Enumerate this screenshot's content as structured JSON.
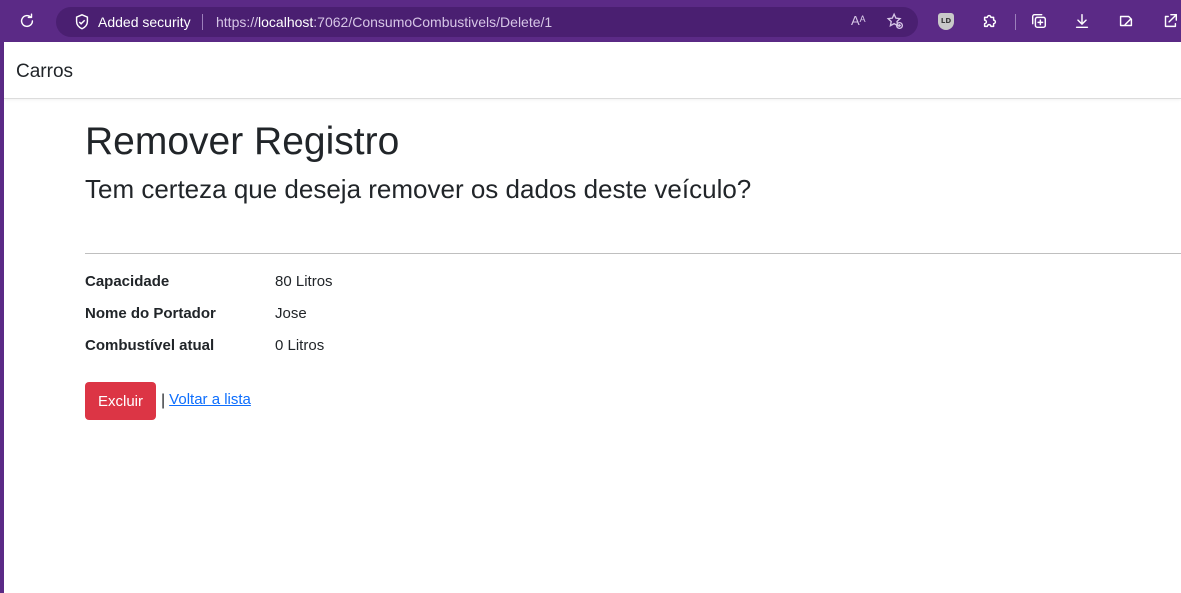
{
  "browser": {
    "security_label": "Added security",
    "url_scheme": "https://",
    "url_host": "localhost",
    "url_rest": ":7062/ConsumoCombustivels/Delete/1",
    "read_aloud_glyph": "Aᴬ",
    "extension_badge": "LD",
    "icons": [
      "refresh-icon",
      "shield-icon",
      "read-aloud-icon",
      "add-favorite-icon",
      "extension-ld-icon",
      "puzzle-icon",
      "collections-icon",
      "download-icon",
      "copilot-icon",
      "share-icon"
    ],
    "accent_color": "#5b2a86"
  },
  "navbar": {
    "brand": "Carros"
  },
  "main": {
    "title": "Remover Registro",
    "subtitle": "Tem certeza que deseja remover os dados deste veículo?",
    "details": [
      {
        "label": "Capacidade",
        "value": "80 Litros"
      },
      {
        "label": "Nome do Portador",
        "value": "Jose"
      },
      {
        "label": "Combustível atual",
        "value": "0 Litros"
      }
    ],
    "delete_button": "Excluir",
    "separator": "|",
    "back_link": "Voltar a lista",
    "danger_color": "#dc3545",
    "link_color": "#0d6efd"
  }
}
